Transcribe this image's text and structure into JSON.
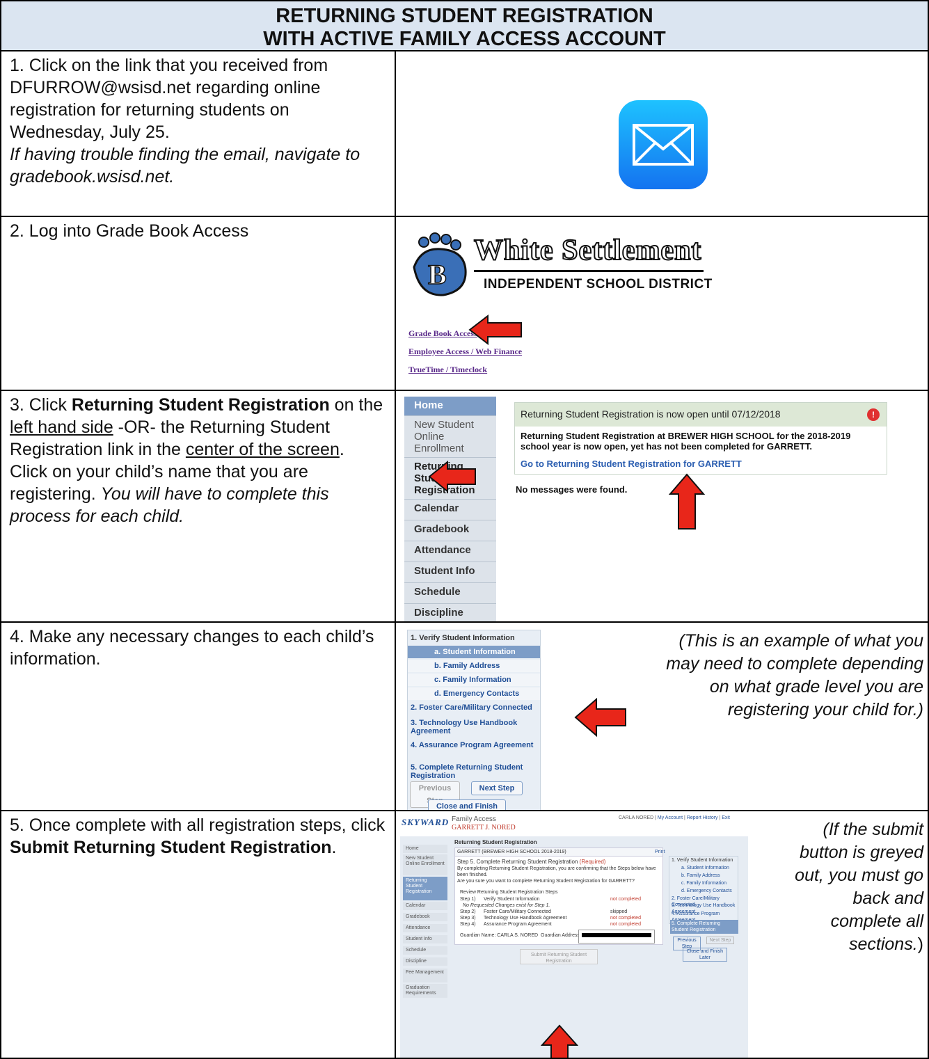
{
  "header": {
    "line1": "RETURNING STUDENT REGISTRATION",
    "line2": "WITH ACTIVE FAMILY ACCESS ACCOUNT"
  },
  "step1": {
    "text": "1. Click on the link that you received from DFURROW@wsisd.net regarding online registration for returning students on Wednesday, July 25.",
    "italic": "If having trouble finding the email, navigate to gradebook.wsisd.net.",
    "icon": "mail-icon"
  },
  "step2": {
    "text": "2.  Log into Grade Book Access",
    "logo_name": "White Settlement",
    "logo_sub": "INDEPENDENT SCHOOL DISTRICT",
    "links": [
      "Grade Book Access",
      "Employee Access / Web Finance",
      "TrueTime / Timeclock"
    ]
  },
  "step3": {
    "pre": "3.  Click ",
    "bold": "Returning Student Registration",
    "mid1": " on the ",
    "ul1": "left hand side",
    "mid2": " -OR- the Returning Student Registration link in the ",
    "ul2": "center of the screen",
    "mid3": ".  Click on your child’s name that you are registering.  ",
    "italic": "You will have to complete this process for each child.",
    "nav": [
      "Home",
      "New Student Online Enrollment",
      "Returning Student Registration",
      "Calendar",
      "Gradebook",
      "Attendance",
      "Student Info",
      "Schedule",
      "Discipline"
    ],
    "msg_header": "Returning Student Registration is now open until 07/12/2018",
    "msg_body": "Returning Student Registration at BREWER HIGH SCHOOL for the 2018-2019 school year is now open, yet has not been completed for GARRETT.",
    "msg_link": "Go to Returning Student Registration for GARRETT",
    "no_msgs": "No messages were found."
  },
  "step4": {
    "text": "4. Make any necessary changes to each child’s information.",
    "note": "(This is an example of what you may need to complete depending on what grade level you are registering your child for.)",
    "items": [
      "1. Verify Student Information",
      "a. Student Information",
      "b. Family Address",
      "c. Family Information",
      "d. Emergency Contacts",
      "2. Foster Care/Military Connected",
      "3. Technology Use Handbook Agreement",
      "4. Assurance Program Agreement",
      "5. Complete Returning Student Registration"
    ],
    "prev": "Previous Step",
    "next": "Next Step",
    "close": "Close and Finish Later"
  },
  "step5": {
    "pre": "5.  Once complete with all registration steps, click ",
    "bold": "Submit Returning Student Registration",
    "post": ".",
    "note_pre": "(If the submit button is greyed out, you must go back and complete all sections.",
    "note_post": ")",
    "sky_title": "Family Access",
    "sky_name": "GARRETT J. NORED",
    "sky_user": "CARLA NORED",
    "sky_toplinks": [
      "My Account",
      "Report History",
      "Exit"
    ],
    "sky_brand": "SKYWARD",
    "page_title": "Returning Student Registration",
    "student": "GARRETT (BREWER HIGH SCHOOL 2018-2019)",
    "print": "Print",
    "step_title": "Step 5. Complete Returning Student Registration",
    "required": "(Required)",
    "confirm": "By completing Returning Student Registration, you are confirming that the Steps below have been finished.",
    "question": "Are you sure you want to complete Returning Student Registration for GARRETT?",
    "review": "Review Returning Student Registration Steps",
    "rows": [
      {
        "step": "Step 1)",
        "name": "Verify Student Information",
        "status": "not completed"
      },
      {
        "step": "",
        "name": "No Requested Changes exist for Step 1.",
        "status": ""
      },
      {
        "step": "Step 2)",
        "name": "Foster Care/Military Connected",
        "status": "skipped"
      },
      {
        "step": "Step 3)",
        "name": "Technology Use Handbook Agreement",
        "status": "not completed"
      },
      {
        "step": "Step 4)",
        "name": "Assurance Program Agreement",
        "status": "not completed"
      }
    ],
    "guardian_name": "Guardian Name: CARLA S. NORED",
    "guardian_addr": "Guardian Address:",
    "submit": "Submit Returning Student Registration",
    "sidenav": [
      "Home",
      "New Student Online Enrollment",
      "Returning Student Registration",
      "Calendar",
      "Gradebook",
      "Attendance",
      "Student Info",
      "Schedule",
      "Discipline",
      "Fee Management",
      "Graduation Requirements"
    ],
    "rightnav": [
      "1. Verify Student Information",
      "a. Student Information",
      "b. Family Address",
      "c. Family Information",
      "d. Emergency Contacts",
      "2. Foster Care/Military Connected",
      "3. Technology Use Handbook Agreement",
      "4. Assurance Program Agreement",
      "5. Complete Returning Student Registration"
    ],
    "prev": "Previous Step",
    "next": "Next Step",
    "close": "Close and Finish Later"
  },
  "colors": {
    "header_bg": "#dbe5f1",
    "arrow": "#e8261a",
    "link": "#2a5db0"
  }
}
